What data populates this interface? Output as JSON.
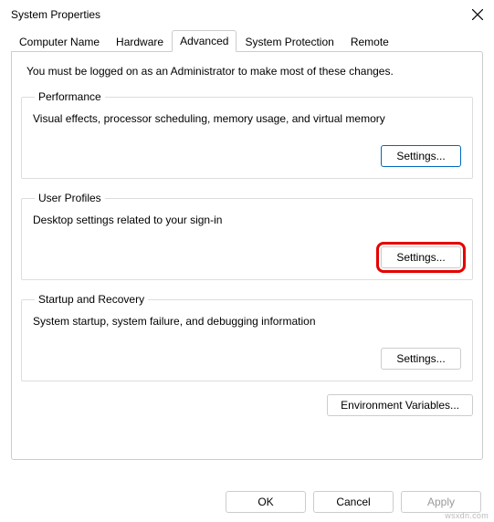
{
  "window": {
    "title": "System Properties"
  },
  "tabs": {
    "computer_name": "Computer Name",
    "hardware": "Hardware",
    "advanced": "Advanced",
    "system_protection": "System Protection",
    "remote": "Remote"
  },
  "intro": "You must be logged on as an Administrator to make most of these changes.",
  "performance": {
    "legend": "Performance",
    "desc": "Visual effects, processor scheduling, memory usage, and virtual memory",
    "button": "Settings..."
  },
  "user_profiles": {
    "legend": "User Profiles",
    "desc": "Desktop settings related to your sign-in",
    "button": "Settings..."
  },
  "startup_recovery": {
    "legend": "Startup and Recovery",
    "desc": "System startup, system failure, and debugging information",
    "button": "Settings..."
  },
  "env_button": "Environment Variables...",
  "dialog_buttons": {
    "ok": "OK",
    "cancel": "Cancel",
    "apply": "Apply"
  },
  "watermark": "wsxdn.com"
}
